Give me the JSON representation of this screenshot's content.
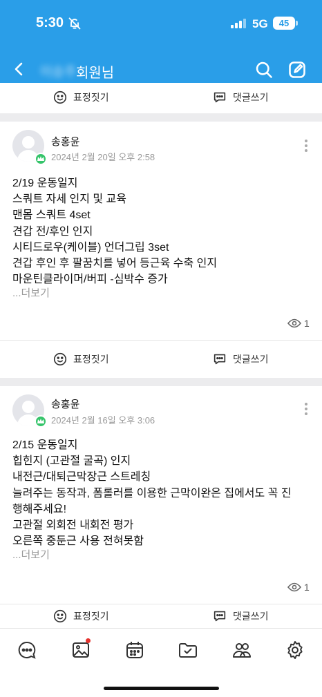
{
  "status": {
    "time": "5:30",
    "network": "5G",
    "battery": "45"
  },
  "header": {
    "name_blurred": "이승주",
    "title": "회원님"
  },
  "actions": {
    "emoji_label": "표정짓기",
    "comment_label": "댓글쓰기"
  },
  "posts": [
    {
      "author": "송홍윤",
      "date": "2024년 2월 20일 오후 2:58",
      "lines": [
        "2/19 운동일지",
        "스쿼트 자세 인지 및 교육",
        "맨몸 스쿼트 4set",
        "견갑 전/후인 인지",
        "시티드로우(케이블) 언더그립 3set",
        "견갑 후인 후 팔꿈치를 넣어 등근육 수축 인지",
        "마운틴클라이머/버피 -심박수 증가"
      ],
      "read_more": "...더보기",
      "views": "1"
    },
    {
      "author": "송홍윤",
      "date": "2024년 2월 16일 오후 3:06",
      "lines": [
        "2/15 운동일지",
        "힙힌지 (고관절 굴곡) 인지",
        "내전근/대퇴근막장근 스트레칭",
        "늘려주는 동작과, 폼롤러를 이용한 근막이완은 집에서도 꼭 진",
        "행해주세요!",
        "고관절 외회전 내회전 평가",
        "오른쪽 중둔근 사용 전혀못함"
      ],
      "read_more": "...더보기",
      "views": "1"
    }
  ],
  "tabbar": {
    "icons": [
      "chat-icon",
      "gallery-icon",
      "calendar-icon",
      "folder-check-icon",
      "members-icon",
      "settings-icon"
    ],
    "badge_color": "#e5322d"
  },
  "colors": {
    "accent": "#2a9ee8",
    "crown_badge": "#35c46a"
  }
}
